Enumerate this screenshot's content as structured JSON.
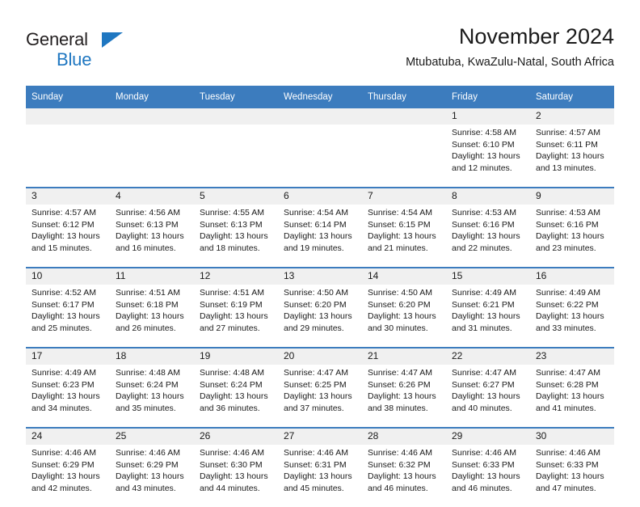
{
  "brand": {
    "name_part1": "General",
    "name_part2": "Blue",
    "logo_icon": "blue-triangle-icon",
    "colors": {
      "dark": "#231f20",
      "blue": "#1f77c1"
    }
  },
  "header": {
    "title": "November 2024",
    "subtitle": "Mtubatuba, KwaZulu-Natal, South Africa"
  },
  "theme": {
    "header_blue": "#3c7cbe",
    "daynum_bg": "#f0f0f0",
    "text": "#1a1a1a"
  },
  "calendar": {
    "weekday_headers": [
      "Sunday",
      "Monday",
      "Tuesday",
      "Wednesday",
      "Thursday",
      "Friday",
      "Saturday"
    ],
    "weeks": [
      [
        {
          "day": "",
          "empty": true
        },
        {
          "day": "",
          "empty": true
        },
        {
          "day": "",
          "empty": true
        },
        {
          "day": "",
          "empty": true
        },
        {
          "day": "",
          "empty": true
        },
        {
          "day": "1",
          "sunrise": "Sunrise: 4:58 AM",
          "sunset": "Sunset: 6:10 PM",
          "daylight_line1": "Daylight: 13 hours",
          "daylight_line2": "and 12 minutes."
        },
        {
          "day": "2",
          "sunrise": "Sunrise: 4:57 AM",
          "sunset": "Sunset: 6:11 PM",
          "daylight_line1": "Daylight: 13 hours",
          "daylight_line2": "and 13 minutes."
        }
      ],
      [
        {
          "day": "3",
          "sunrise": "Sunrise: 4:57 AM",
          "sunset": "Sunset: 6:12 PM",
          "daylight_line1": "Daylight: 13 hours",
          "daylight_line2": "and 15 minutes."
        },
        {
          "day": "4",
          "sunrise": "Sunrise: 4:56 AM",
          "sunset": "Sunset: 6:13 PM",
          "daylight_line1": "Daylight: 13 hours",
          "daylight_line2": "and 16 minutes."
        },
        {
          "day": "5",
          "sunrise": "Sunrise: 4:55 AM",
          "sunset": "Sunset: 6:13 PM",
          "daylight_line1": "Daylight: 13 hours",
          "daylight_line2": "and 18 minutes."
        },
        {
          "day": "6",
          "sunrise": "Sunrise: 4:54 AM",
          "sunset": "Sunset: 6:14 PM",
          "daylight_line1": "Daylight: 13 hours",
          "daylight_line2": "and 19 minutes."
        },
        {
          "day": "7",
          "sunrise": "Sunrise: 4:54 AM",
          "sunset": "Sunset: 6:15 PM",
          "daylight_line1": "Daylight: 13 hours",
          "daylight_line2": "and 21 minutes."
        },
        {
          "day": "8",
          "sunrise": "Sunrise: 4:53 AM",
          "sunset": "Sunset: 6:16 PM",
          "daylight_line1": "Daylight: 13 hours",
          "daylight_line2": "and 22 minutes."
        },
        {
          "day": "9",
          "sunrise": "Sunrise: 4:53 AM",
          "sunset": "Sunset: 6:16 PM",
          "daylight_line1": "Daylight: 13 hours",
          "daylight_line2": "and 23 minutes."
        }
      ],
      [
        {
          "day": "10",
          "sunrise": "Sunrise: 4:52 AM",
          "sunset": "Sunset: 6:17 PM",
          "daylight_line1": "Daylight: 13 hours",
          "daylight_line2": "and 25 minutes."
        },
        {
          "day": "11",
          "sunrise": "Sunrise: 4:51 AM",
          "sunset": "Sunset: 6:18 PM",
          "daylight_line1": "Daylight: 13 hours",
          "daylight_line2": "and 26 minutes."
        },
        {
          "day": "12",
          "sunrise": "Sunrise: 4:51 AM",
          "sunset": "Sunset: 6:19 PM",
          "daylight_line1": "Daylight: 13 hours",
          "daylight_line2": "and 27 minutes."
        },
        {
          "day": "13",
          "sunrise": "Sunrise: 4:50 AM",
          "sunset": "Sunset: 6:20 PM",
          "daylight_line1": "Daylight: 13 hours",
          "daylight_line2": "and 29 minutes."
        },
        {
          "day": "14",
          "sunrise": "Sunrise: 4:50 AM",
          "sunset": "Sunset: 6:20 PM",
          "daylight_line1": "Daylight: 13 hours",
          "daylight_line2": "and 30 minutes."
        },
        {
          "day": "15",
          "sunrise": "Sunrise: 4:49 AM",
          "sunset": "Sunset: 6:21 PM",
          "daylight_line1": "Daylight: 13 hours",
          "daylight_line2": "and 31 minutes."
        },
        {
          "day": "16",
          "sunrise": "Sunrise: 4:49 AM",
          "sunset": "Sunset: 6:22 PM",
          "daylight_line1": "Daylight: 13 hours",
          "daylight_line2": "and 33 minutes."
        }
      ],
      [
        {
          "day": "17",
          "sunrise": "Sunrise: 4:49 AM",
          "sunset": "Sunset: 6:23 PM",
          "daylight_line1": "Daylight: 13 hours",
          "daylight_line2": "and 34 minutes."
        },
        {
          "day": "18",
          "sunrise": "Sunrise: 4:48 AM",
          "sunset": "Sunset: 6:24 PM",
          "daylight_line1": "Daylight: 13 hours",
          "daylight_line2": "and 35 minutes."
        },
        {
          "day": "19",
          "sunrise": "Sunrise: 4:48 AM",
          "sunset": "Sunset: 6:24 PM",
          "daylight_line1": "Daylight: 13 hours",
          "daylight_line2": "and 36 minutes."
        },
        {
          "day": "20",
          "sunrise": "Sunrise: 4:47 AM",
          "sunset": "Sunset: 6:25 PM",
          "daylight_line1": "Daylight: 13 hours",
          "daylight_line2": "and 37 minutes."
        },
        {
          "day": "21",
          "sunrise": "Sunrise: 4:47 AM",
          "sunset": "Sunset: 6:26 PM",
          "daylight_line1": "Daylight: 13 hours",
          "daylight_line2": "and 38 minutes."
        },
        {
          "day": "22",
          "sunrise": "Sunrise: 4:47 AM",
          "sunset": "Sunset: 6:27 PM",
          "daylight_line1": "Daylight: 13 hours",
          "daylight_line2": "and 40 minutes."
        },
        {
          "day": "23",
          "sunrise": "Sunrise: 4:47 AM",
          "sunset": "Sunset: 6:28 PM",
          "daylight_line1": "Daylight: 13 hours",
          "daylight_line2": "and 41 minutes."
        }
      ],
      [
        {
          "day": "24",
          "sunrise": "Sunrise: 4:46 AM",
          "sunset": "Sunset: 6:29 PM",
          "daylight_line1": "Daylight: 13 hours",
          "daylight_line2": "and 42 minutes."
        },
        {
          "day": "25",
          "sunrise": "Sunrise: 4:46 AM",
          "sunset": "Sunset: 6:29 PM",
          "daylight_line1": "Daylight: 13 hours",
          "daylight_line2": "and 43 minutes."
        },
        {
          "day": "26",
          "sunrise": "Sunrise: 4:46 AM",
          "sunset": "Sunset: 6:30 PM",
          "daylight_line1": "Daylight: 13 hours",
          "daylight_line2": "and 44 minutes."
        },
        {
          "day": "27",
          "sunrise": "Sunrise: 4:46 AM",
          "sunset": "Sunset: 6:31 PM",
          "daylight_line1": "Daylight: 13 hours",
          "daylight_line2": "and 45 minutes."
        },
        {
          "day": "28",
          "sunrise": "Sunrise: 4:46 AM",
          "sunset": "Sunset: 6:32 PM",
          "daylight_line1": "Daylight: 13 hours",
          "daylight_line2": "and 46 minutes."
        },
        {
          "day": "29",
          "sunrise": "Sunrise: 4:46 AM",
          "sunset": "Sunset: 6:33 PM",
          "daylight_line1": "Daylight: 13 hours",
          "daylight_line2": "and 46 minutes."
        },
        {
          "day": "30",
          "sunrise": "Sunrise: 4:46 AM",
          "sunset": "Sunset: 6:33 PM",
          "daylight_line1": "Daylight: 13 hours",
          "daylight_line2": "and 47 minutes."
        }
      ]
    ]
  }
}
